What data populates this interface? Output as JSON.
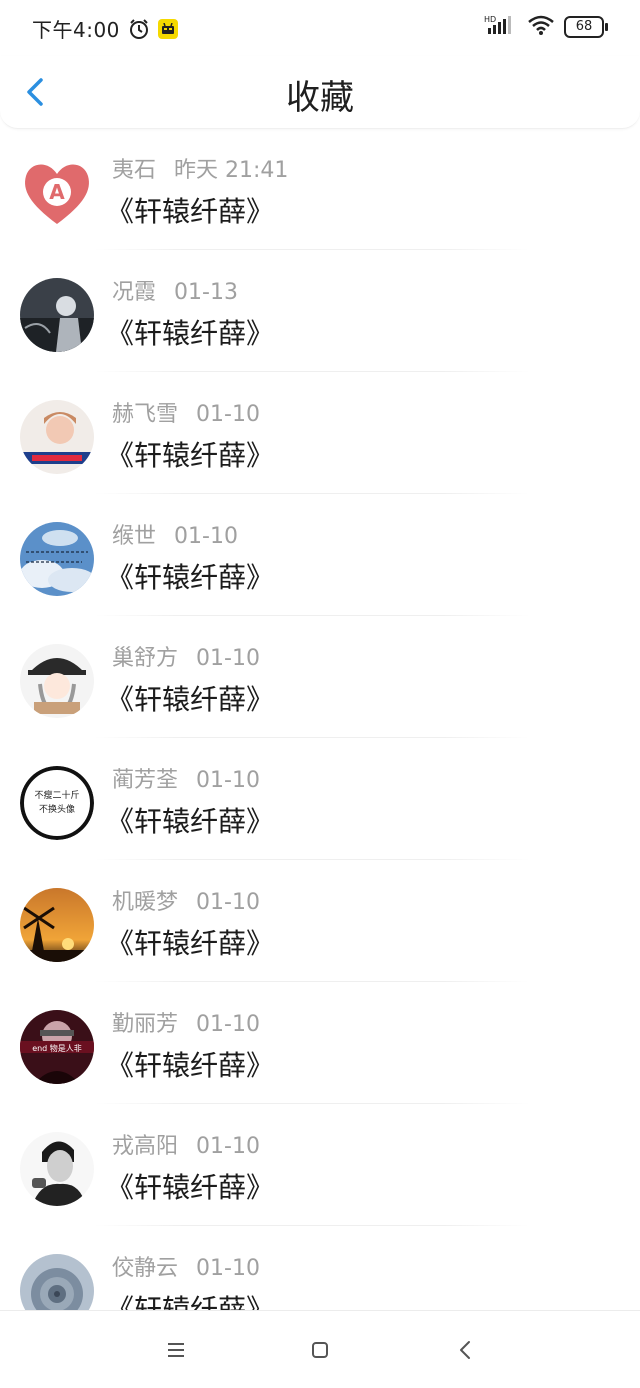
{
  "status_bar": {
    "time": "下午4:00",
    "network_label": "HD",
    "battery": "68"
  },
  "header": {
    "title": "收藏",
    "back_icon": "chevron-left-icon"
  },
  "items": [
    {
      "name": "夷石",
      "time": "昨天 21:41",
      "content": "《轩辕纤薛》"
    },
    {
      "name": "况霞",
      "time": "01-13",
      "content": "《轩辕纤薛》"
    },
    {
      "name": "赫飞雪",
      "time": "01-10",
      "content": "《轩辕纤薛》"
    },
    {
      "name": "缑世",
      "time": "01-10",
      "content": "《轩辕纤薛》"
    },
    {
      "name": "巢舒方",
      "time": "01-10",
      "content": "《轩辕纤薛》"
    },
    {
      "name": "蔺芳荃",
      "time": "01-10",
      "content": "《轩辕纤薛》"
    },
    {
      "name": "机暖梦",
      "time": "01-10",
      "content": "《轩辕纤薛》"
    },
    {
      "name": "勤丽芳",
      "time": "01-10",
      "content": "《轩辕纤薛》"
    },
    {
      "name": "戎高阳",
      "time": "01-10",
      "content": "《轩辕纤薛》"
    },
    {
      "name": "佼静云",
      "time": "01-10",
      "content": "《轩辕纤薛》"
    }
  ],
  "avatar_texts": {
    "first": "A",
    "sixth_line1": "不瘦二十斤",
    "sixth_line2": "不换头像",
    "eighth": "end 物是人非"
  },
  "colors": {
    "accent": "#2b8fe0",
    "meta_text": "#a0a0a0",
    "content_text": "#1c1c1c"
  }
}
